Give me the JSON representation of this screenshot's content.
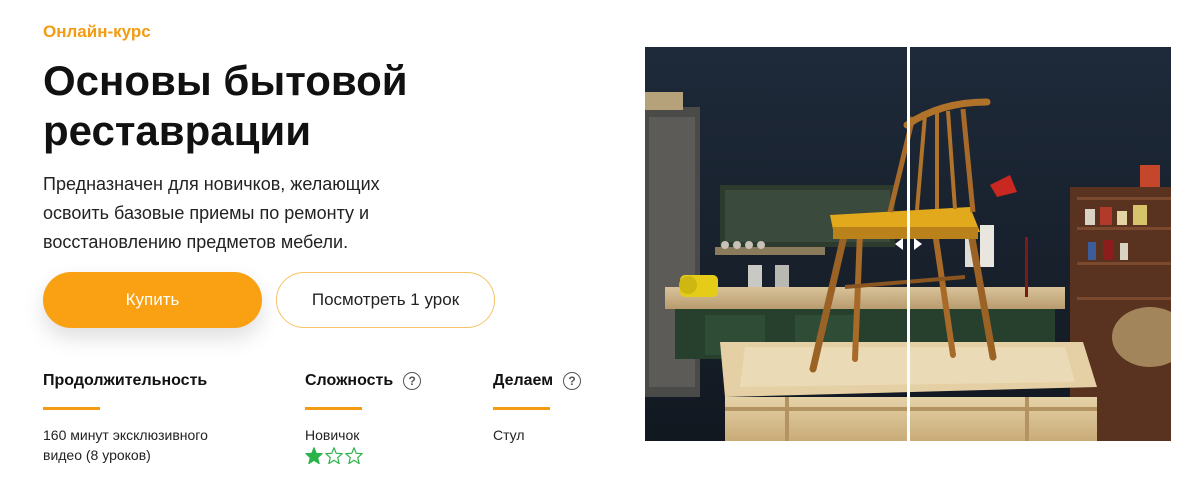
{
  "hero": {
    "eyebrow": "Онлайн-курс",
    "title": "Основы бытовой реставрации",
    "description": "Предназначен для новичков, желающих освоить базовые приемы по ремонту и восстановлению предметов мебели."
  },
  "buttons": {
    "buy_label": "Купить",
    "lesson_label": "Посмотреть 1 урок"
  },
  "stats": {
    "duration": {
      "label": "Продолжительность",
      "value": "160 минут эксклюзивного видео (8 уроков)"
    },
    "difficulty": {
      "label": "Сложность",
      "value": "Новичок",
      "help_icon": "question-circle-icon",
      "rating": 1,
      "rating_max": 3
    },
    "making": {
      "label": "Делаем",
      "value": "Стул",
      "help_icon": "question-circle-icon"
    }
  },
  "media": {
    "comparison_split": 0.5,
    "handle_icon": "double-arrow-handle-icon"
  },
  "colors": {
    "accent": "#f39c12",
    "button": "#f9a013",
    "button_outline": "#f6c366",
    "star": "#2bb34a"
  }
}
